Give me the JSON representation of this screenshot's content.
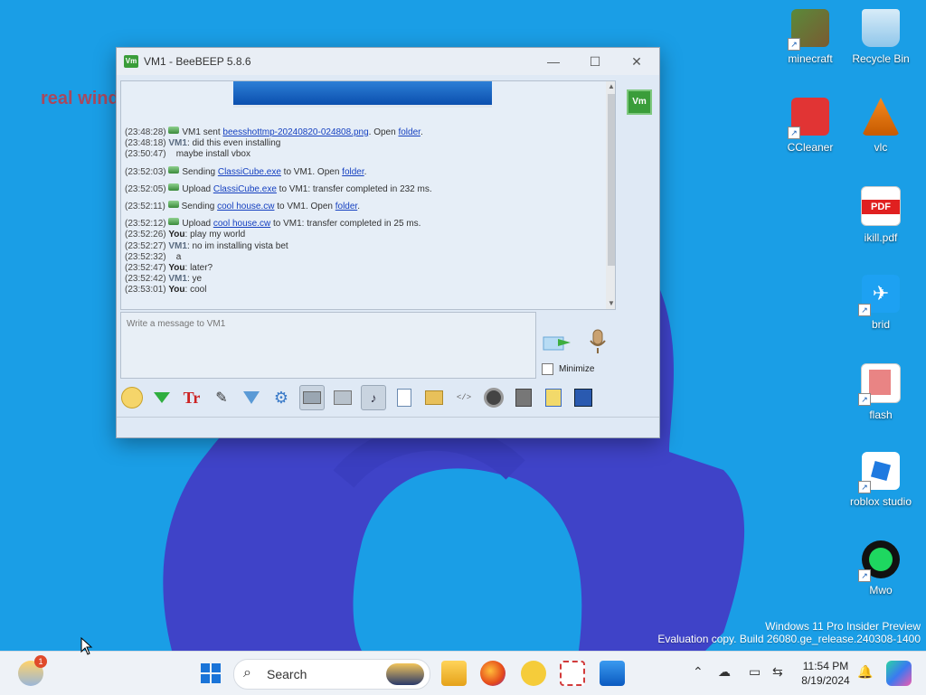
{
  "desktop": {
    "wall_text": "real wind",
    "icons": [
      {
        "label": "minecraft"
      },
      {
        "label": "Recycle Bin"
      },
      {
        "label": "CCleaner"
      },
      {
        "label": "vlc"
      },
      {
        "label": "ikill.pdf"
      },
      {
        "label": "brid"
      },
      {
        "label": "flash"
      },
      {
        "label": "roblox studio"
      },
      {
        "label": "Mwo"
      }
    ],
    "watermark_line1": "Windows 11 Pro Insider Preview",
    "watermark_line2": "Evaluation copy. Build 26080.ge_release.240308-1400"
  },
  "window": {
    "title": "VM1 - BeeBEEP 5.8.6",
    "app_icon": "Vm",
    "user_badge": "Vm",
    "messages": [
      {
        "ts": "(23:48:28)",
        "icon": true,
        "parts": [
          [
            "t",
            "VM1 sent "
          ],
          [
            "l",
            "beesshottmp-20240820-024808.png"
          ],
          [
            "t",
            ". Open "
          ],
          [
            "l",
            "folder"
          ],
          [
            "t",
            "."
          ]
        ]
      },
      {
        "ts": "(23:48:18)",
        "who": "VM1",
        "text": ": did this even installing"
      },
      {
        "ts": "(23:50:47)",
        "text": "   maybe install vbox"
      },
      {
        "ts": "(23:52:03)",
        "icon": true,
        "parts": [
          [
            "t",
            "Sending "
          ],
          [
            "l",
            "ClassiCube.exe"
          ],
          [
            "t",
            " to VM1. Open "
          ],
          [
            "l",
            "folder"
          ],
          [
            "t",
            "."
          ]
        ]
      },
      {
        "ts": "(23:52:05)",
        "icon": true,
        "parts": [
          [
            "t",
            "Upload "
          ],
          [
            "l",
            "ClassiCube.exe"
          ],
          [
            "t",
            " to VM1: transfer completed in 232 ms."
          ]
        ]
      },
      {
        "ts": "(23:52:11)",
        "icon": true,
        "parts": [
          [
            "t",
            "Sending "
          ],
          [
            "l",
            "cool house.cw"
          ],
          [
            "t",
            " to VM1. Open "
          ],
          [
            "l",
            "folder"
          ],
          [
            "t",
            "."
          ]
        ]
      },
      {
        "ts": "(23:52:12)",
        "icon": true,
        "parts": [
          [
            "t",
            "Upload "
          ],
          [
            "l",
            "cool house.cw"
          ],
          [
            "t",
            " to VM1: transfer completed in 25 ms."
          ]
        ]
      },
      {
        "ts": "(23:52:26)",
        "who": "You",
        "text": ": play my world"
      },
      {
        "ts": "(23:52:27)",
        "who": "VM1",
        "text": ": no im installing vista bet"
      },
      {
        "ts": "(23:52:32)",
        "text": "   a"
      },
      {
        "ts": "(23:52:47)",
        "who": "You",
        "text": ": later?"
      },
      {
        "ts": "(23:52:42)",
        "who": "VM1",
        "text": ": ye"
      },
      {
        "ts": "(23:53:01)",
        "who": "You",
        "text": ": cool"
      }
    ],
    "input_placeholder": "Write a message to VM1",
    "minimize_label": "Minimize",
    "toolbar": [
      "emoticons-icon",
      "green-arrow-icon",
      "font-icon",
      "pen-color-icon",
      "filter-icon",
      "settings-gear-icon",
      "screenshot-icon",
      "window-icon",
      "music-icon",
      "send-file-icon",
      "send-folder-icon",
      "html-icon",
      "webcam-icon",
      "calculator-icon",
      "note-icon",
      "save-icon"
    ]
  },
  "taskbar": {
    "weather_badge": "1",
    "search_label": "Search",
    "time": "11:54 PM",
    "date": "8/19/2024"
  }
}
